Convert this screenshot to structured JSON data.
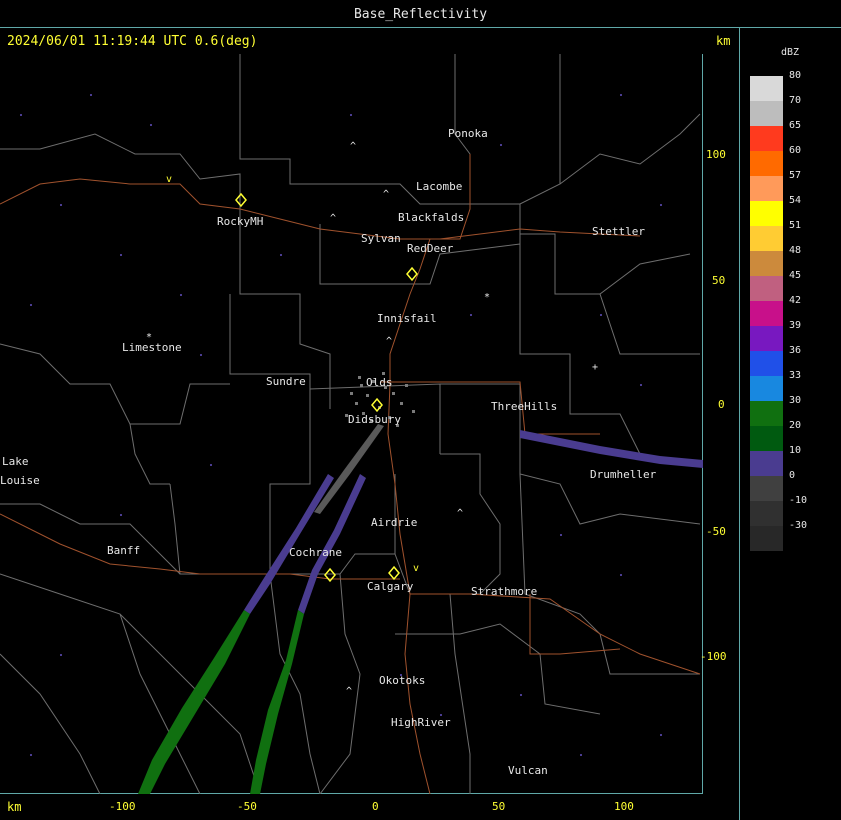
{
  "window": {
    "title": "Base_Reflectivity"
  },
  "header": {
    "timestamp": "2024/06/01 11:19:44 UTC 0.6(deg)",
    "unit_top": "km"
  },
  "footer": {
    "unit_bottom": "km"
  },
  "axes": {
    "y_ticks": [
      "100",
      "50",
      "0",
      "-50",
      "-100"
    ],
    "x_ticks": [
      "-100",
      "-50",
      "0",
      "50",
      "100"
    ]
  },
  "cities": {
    "ponoka": "Ponoka",
    "lacombe": "Lacombe",
    "blackfalds": "Blackfalds",
    "sylvan": "Sylvan",
    "reddeer": "RedDeer",
    "rockymh": "RockyMH",
    "stettler": "Stettler",
    "innisfail": "Innisfail",
    "limestone": "Limestone",
    "sundre": "Sundre",
    "olds": "Olds",
    "didsbury": "Didsbury",
    "threehills": "ThreeHills",
    "drumheller": "Drumheller",
    "lake": "Lake",
    "louise": "Louise",
    "airdrie": "Airdrie",
    "banff": "Banff",
    "cochrane": "Cochrane",
    "calgary": "Calgary",
    "strathmore": "Strathmore",
    "okotoks": "Okotoks",
    "highriver": "HighRiver",
    "vulcan": "Vulcan"
  },
  "legend": {
    "unit": "dBZ",
    "labels": [
      "80",
      "70",
      "65",
      "60",
      "57",
      "54",
      "51",
      "48",
      "45",
      "42",
      "39",
      "36",
      "33",
      "30",
      "20",
      "10",
      "0",
      "-10",
      "-30"
    ],
    "colors": [
      "#d9d9d9",
      "#bdbdbd",
      "#ff3a1e",
      "#ff6a00",
      "#ff9a5a",
      "#ffff00",
      "#ffcc33",
      "#cc8a3c",
      "#c06080",
      "#c8108a",
      "#7818c0",
      "#2050e8",
      "#1888e0",
      "#107010",
      "#005a10",
      "#4a3c90",
      "#404040",
      "#303030",
      "#282828"
    ]
  },
  "colors": {
    "accent": "#ffff33",
    "border": "#5fa8a8",
    "county_lines": "#7a7a7a",
    "highways": "#a0522d"
  }
}
